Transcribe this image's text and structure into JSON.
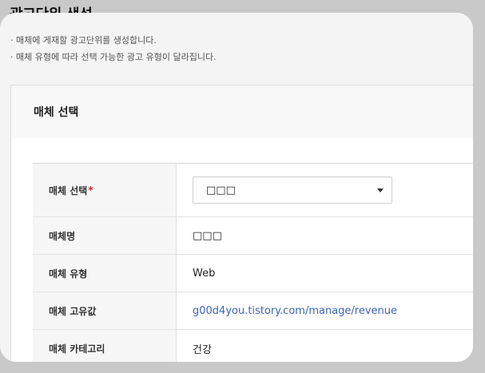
{
  "page": {
    "title": "광고단위 생성",
    "descriptions": [
      "· 매체에 게재할 광고단위를 생성합니다.",
      "· 매체 유형에 따라 선택 가능한 광고 유형이 달라집니다."
    ]
  },
  "panel": {
    "title": "매체 선택",
    "rows": {
      "media_select": {
        "label": "매체 선택",
        "required_mark": "*",
        "value": "□□□"
      },
      "media_name": {
        "label": "매체명",
        "value": "□□□"
      },
      "media_type": {
        "label": "매체 유형",
        "value": "Web"
      },
      "media_unique_value": {
        "label": "매체 고유값",
        "value": "g00d4you.tistory.com/manage/revenue"
      },
      "media_category": {
        "label": "매체 카테고리",
        "value": "건강"
      }
    }
  }
}
